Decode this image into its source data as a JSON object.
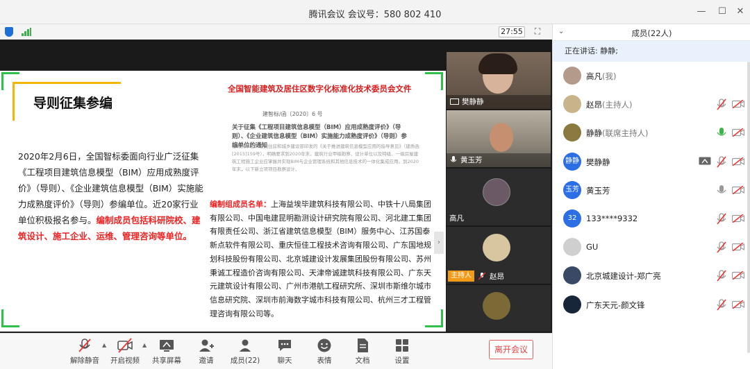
{
  "window": {
    "title": "腾讯会议 会议号：580 802 410",
    "minimize_glyph": "—",
    "maximize_glyph": "☐",
    "close_glyph": "✕"
  },
  "status": {
    "timer": "27:55",
    "fullscreen_glyph": "⛶"
  },
  "slide": {
    "title": "导则征集参编",
    "paragraph": "2020年2月6日，全国智标委面向行业广泛征集《工程项目建筑信息模型（BIM）应用成熟度评价》（导则）、《企业建筑信息模型（BIM）实施能力成熟度评价》（导则）参编单位。近20家行业单位积极报名参与。",
    "paragraph_highlight": "编制成员包括科研院校、建筑设计、施工企业、运维、管理咨询等单位。",
    "doc_header": "全国智能建筑及居住区数字化标准化技术委员会文件",
    "doc_number": "建智标/函〔2020〕6 号",
    "doc_heading": "关于征集《工程项目建筑信息模型（BIM）应用成熟度评价》（导则）、《企业建筑信息模型（BIM）实施能力成熟度评价》（导则）参编单位的通知",
    "doc_text": "各有关单位：根据住房和城乡建设部印发的《关于推进建筑信息模型应用的指导意见》（建质函[2015]159号），明确要求到2020年末，建筑行业甲级勘察、设计单位以及特级、一级房屋建筑工程施工企业应掌握并实现BIM与企业管理系统和其他信息技术的一体化集成应用。到2020年末，以下新立项项目勘察设计、",
    "members_label": "编制组成员名单：",
    "members_text": "上海益埃毕建筑科技有限公司、中铁十八局集团有限公司、中国电建昆明勘测设计研究院有限公司、河北建工集团有限责任公司、浙江省建筑信息模型（BIM）服务中心、江苏国泰新点软件有限公司、重庆恒佳工程技术咨询有限公司、广东国地规划科技股份有限公司、北京城建设计发展集团股份有限公司、苏州秉诚工程造价咨询有限公司、天津帝诚建筑科技有限公司、广东天元建筑设计有限公司、广州市港航工程研究所、深圳市斯维尔城市信息研究院、深圳市前海数字城市科技有限公司、杭州三才工程管理咨询有限公司等。",
    "next_glyph": "›"
  },
  "tiles": [
    {
      "name": "樊静静"
    },
    {
      "name": "黄玉芳"
    },
    {
      "name": "高凡"
    },
    {
      "name": "赵昂",
      "badge": "主持人"
    },
    {
      "name": ""
    }
  ],
  "toolbar": {
    "mute": "解除静音",
    "video": "开启视频",
    "share": "共享屏幕",
    "invite": "邀请",
    "members": "成员(22)",
    "chat": "聊天",
    "emoji": "表情",
    "docs": "文档",
    "settings": "设置",
    "leave": "离开会议",
    "caret": "▲"
  },
  "panel": {
    "title": "成员(22人)",
    "chevron": "⌄",
    "speaking": "正在讲话: 静静;",
    "members": [
      {
        "name": "高凡",
        "role": "(我)",
        "avatar_text": "",
        "avatar_color": "#b49a8a",
        "mic": "none",
        "cam": "none"
      },
      {
        "name": "赵昂",
        "role": "(主持人)",
        "avatar_text": "",
        "avatar_color": "#c8b48a",
        "mic": "muted",
        "cam": "off"
      },
      {
        "name": "静静",
        "role": "(联席主持人)",
        "avatar_text": "",
        "avatar_color": "#8a7a40",
        "mic": "on",
        "cam": "off"
      },
      {
        "name": "樊静静",
        "role": "",
        "avatar_text": "静静",
        "avatar_color": "#2b6ee6",
        "mic": "muted",
        "cam": "off",
        "share": true
      },
      {
        "name": "黄玉芳",
        "role": "",
        "avatar_text": "玉芳",
        "avatar_color": "#2b6ee6",
        "mic": "on-gray",
        "cam": "off"
      },
      {
        "name": "133****9332",
        "role": "",
        "avatar_text": "32",
        "avatar_color": "#2b6ee6",
        "mic": "muted",
        "cam": "off"
      },
      {
        "name": "GU",
        "role": "",
        "avatar_text": "",
        "avatar_color": "#cfcfcf",
        "mic": "muted",
        "cam": "off"
      },
      {
        "name": "北京城建设计-郑广亮",
        "role": "",
        "avatar_text": "",
        "avatar_color": "#3a4a66",
        "mic": "muted",
        "cam": "off"
      },
      {
        "name": "广东天元-颜文锋",
        "role": "",
        "avatar_text": "",
        "avatar_color": "#18263a",
        "mic": "muted",
        "cam": "off"
      }
    ]
  }
}
